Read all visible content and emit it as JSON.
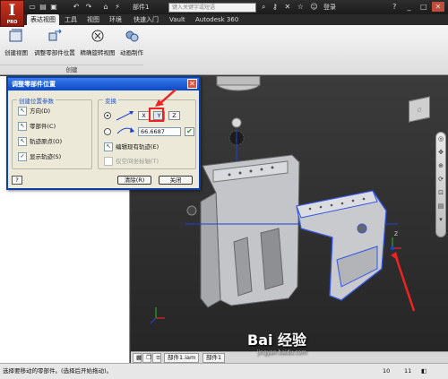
{
  "app": {
    "logo_letter": "I",
    "logo_sub": "PRO",
    "document_title": "部件1",
    "search_placeholder": "键入关键字或短语",
    "login_label": "登录"
  },
  "tabs": [
    {
      "label": "表达视图",
      "active": true
    },
    {
      "label": "工具"
    },
    {
      "label": "视图"
    },
    {
      "label": "环境"
    },
    {
      "label": "快速入门"
    },
    {
      "label": "Vault"
    },
    {
      "label": "Autodesk 360"
    }
  ],
  "ribbon": {
    "buttons": [
      {
        "label": "创建视图",
        "icon": "create-view-icon"
      },
      {
        "label": "调整零部件位置",
        "icon": "tweak-components-icon"
      },
      {
        "label": "精确旋转视图",
        "icon": "precise-rotate-icon"
      },
      {
        "label": "动画制作",
        "icon": "animation-icon"
      }
    ],
    "group_label": "创建"
  },
  "dialog": {
    "title": "调整零部件位置",
    "section_left": "创建位置参数",
    "direction": "方向(D)",
    "components": "零部件(C)",
    "trail_origin": "轨迹原点(O)",
    "display_trails": "显示轨迹(S)",
    "section_right": "变换",
    "axis_x": "X",
    "axis_y": "Y",
    "axis_z": "Z",
    "distance_value": "66.6687",
    "edit_trails": "编辑现有轨迹(E)",
    "triad_only": "仅空间坐标轴(T)",
    "clear": "清除(R)",
    "close": "关闭",
    "help": "?"
  },
  "doc_tabs": [
    {
      "label": "部件1.iam"
    },
    {
      "label": "部件1"
    }
  ],
  "status": {
    "message": "选择要移动的零部件。(选择后开始拖动)。",
    "count_a": "10",
    "count_b": "11"
  },
  "watermark": {
    "text": "Bai 经验",
    "sub": "jingyan.baidu.com"
  },
  "colors": {
    "accent_red": "#e22222",
    "title_blue": "#0a49c8",
    "model_grey": "#c3c5c9"
  }
}
